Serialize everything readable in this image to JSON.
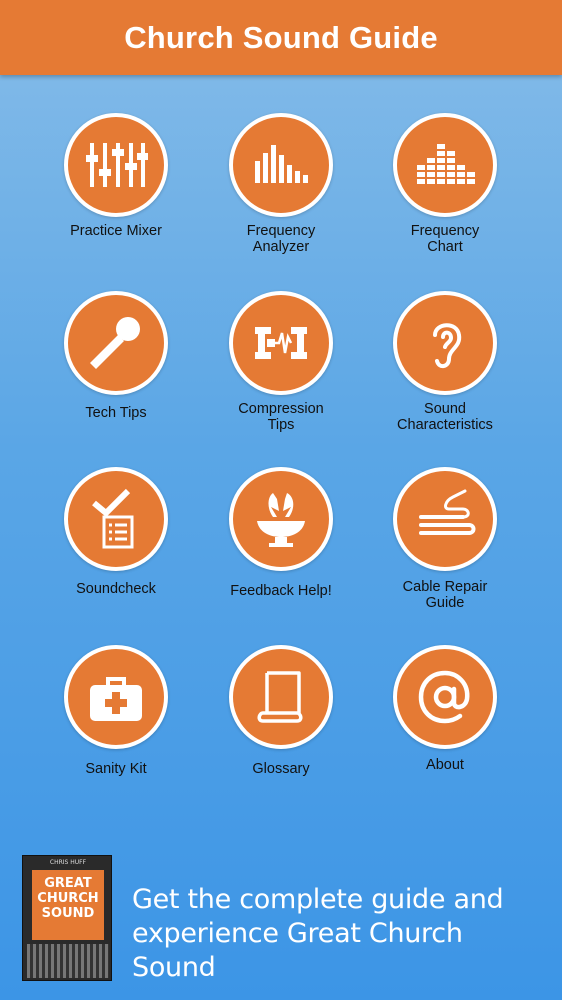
{
  "header": {
    "title": "Church Sound Guide"
  },
  "colors": {
    "accent": "#e57a34",
    "background_top": "#86bce8",
    "background_bottom": "#3c95e6"
  },
  "menu": [
    {
      "label": "Practice Mixer",
      "icon": "mixer-faders-icon"
    },
    {
      "label": "Frequency\nAnalyzer",
      "icon": "frequency-bars-icon"
    },
    {
      "label": "Frequency\nChart",
      "icon": "equalizer-chart-icon"
    },
    {
      "label": "Tech Tips",
      "icon": "microphone-icon"
    },
    {
      "label": "Compression\nTips",
      "icon": "compressor-clamp-icon"
    },
    {
      "label": "Sound\nCharacteristics",
      "icon": "ear-icon"
    },
    {
      "label": "Soundcheck",
      "icon": "checklist-icon"
    },
    {
      "label": "Feedback Help!",
      "icon": "feedback-bowl-icon"
    },
    {
      "label": "Cable Repair\nGuide",
      "icon": "cable-icon"
    },
    {
      "label": "Sanity Kit",
      "icon": "first-aid-kit-icon"
    },
    {
      "label": "Glossary",
      "icon": "scroll-icon"
    },
    {
      "label": "About",
      "icon": "at-sign-icon"
    }
  ],
  "promo": {
    "book_author": "CHRIS HUFF",
    "book_title": "GREAT\nCHURCH\nSOUND",
    "text": "Get the complete guide and\nexperience Great Church Sound"
  }
}
